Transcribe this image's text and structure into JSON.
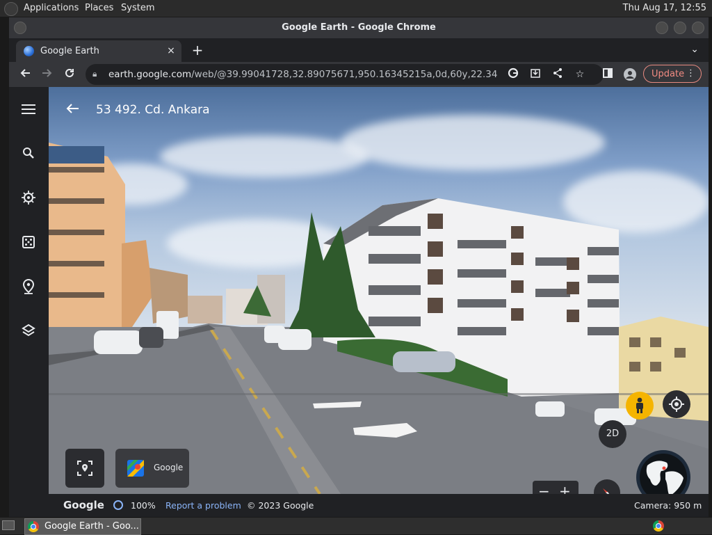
{
  "top_panel": {
    "menus": [
      "Applications",
      "Places",
      "System"
    ],
    "clock": "Thu Aug 17, 12:55"
  },
  "window": {
    "title": "Google Earth - Google Chrome",
    "tab_title": "Google Earth",
    "tab_close": "×",
    "new_tab": "+",
    "url_host": "earth.google.com",
    "url_path": "/web/@39.99041728,32.89075671,950.16345215a,0d,60y,22.3402816...",
    "update_label": "Update"
  },
  "earth": {
    "place_title": "53 492. Cd. Ankara",
    "mode_2d": "2D",
    "maps_label": "Google",
    "footer": {
      "brand": "Google",
      "zoom": "100%",
      "report": "Report a problem",
      "copyright": "© 2023 Google",
      "camera": "Camera: 950 m"
    },
    "watermark": "© 2023 Google"
  },
  "taskbar": {
    "item_label": "Google Earth - Goo..."
  },
  "colors": {
    "chrome_dark": "#202124",
    "toolbar": "#35363a",
    "update_accent": "#f28b82",
    "link": "#8ab4f8"
  }
}
